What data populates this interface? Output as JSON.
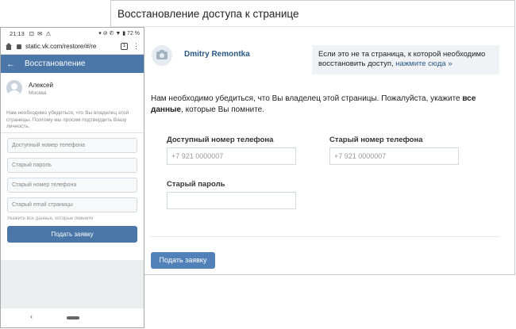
{
  "desktop": {
    "title": "Восстановление доступа к странице",
    "profile_name": "Dmitry Remontka",
    "notice_text": "Если это не та страница, к которой необходимо восстановить доступ,",
    "notice_link": "нажмите сюда »",
    "lead_text": "Нам необходимо убедиться, что Вы владелец этой страницы. Пожалуйста, укажите",
    "lead_bold": "все данные",
    "lead_tail": ", которые Вы помните.",
    "fields": {
      "phone_label": "Доступный номер телефона",
      "phone_placeholder": "+7 921 0000007",
      "old_phone_label": "Старый номер телефона",
      "old_phone_placeholder": "+7 921 0000007",
      "old_password_label": "Старый пароль",
      "old_password_value": ""
    },
    "submit_label": "Подать заявку"
  },
  "mobile": {
    "status": {
      "time": "21:13",
      "icons": "⊡ ✉ ⚠",
      "right": "▾ ⊘ ✆ ▼ ▮ 72 %"
    },
    "url": "static.vk.com/restore/#/re",
    "tab_count": "1",
    "appbar_title": "Восстановление",
    "user_name": "Алексей",
    "user_city": "Москва",
    "info_text": "Нам необходимо убедиться, что Вы владелец этой страницы. Поэтому мы просим подтвердить Вашу личность.",
    "inputs": [
      "Доступный номер телефона",
      "Старый пароль",
      "Старый номер телефона",
      "Старый email страницы"
    ],
    "hint": "Укажите все данные, которые помните",
    "submit_label": "Подать заявку"
  }
}
